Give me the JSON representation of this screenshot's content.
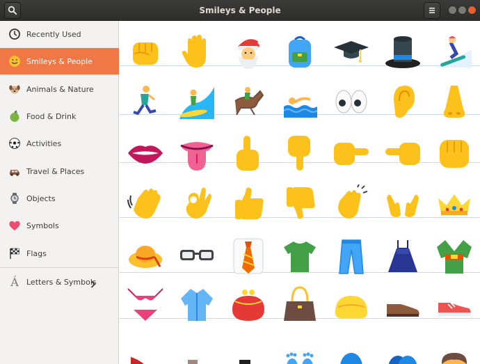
{
  "window": {
    "title": "Smileys & People"
  },
  "header": {
    "search_icon": "search-icon",
    "menu_icon": "hamburger-menu-icon"
  },
  "sidebar": {
    "items": [
      {
        "label": "Recently Used",
        "icon": "clock-icon",
        "active": false
      },
      {
        "label": "Smileys & People",
        "icon": "smiley-icon",
        "active": true
      },
      {
        "label": "Animals & Nature",
        "icon": "dog-icon",
        "active": false
      },
      {
        "label": "Food & Drink",
        "icon": "apple-icon",
        "active": false
      },
      {
        "label": "Activities",
        "icon": "soccer-ball-icon",
        "active": false
      },
      {
        "label": "Travel & Places",
        "icon": "car-icon",
        "active": false
      },
      {
        "label": "Objects",
        "icon": "watch-icon",
        "active": false
      },
      {
        "label": "Symbols",
        "icon": "heart-icon",
        "active": false
      },
      {
        "label": "Flags",
        "icon": "checkered-flag-icon",
        "active": false
      },
      {
        "label": "Letters & Symbols",
        "icon": "accented-a-icon",
        "active": false
      }
    ]
  },
  "emoji_grid": {
    "rows": [
      [
        "raised-fist",
        "raised-hand",
        "santa-claus",
        "backpack",
        "graduation-cap",
        "top-hat",
        "snowboarder"
      ],
      [
        "person-running",
        "person-surfing",
        "horse-racing",
        "person-swimming",
        "eyes",
        "ear",
        "nose"
      ],
      [
        "mouth",
        "tongue",
        "index-pointing-up",
        "index-pointing-down",
        "index-pointing-right",
        "index-pointing-left",
        "oncoming-fist"
      ],
      [
        "waving-hand",
        "ok-hand",
        "thumbs-up",
        "thumbs-down",
        "clapping-hands",
        "open-hands",
        "crown"
      ],
      [
        "womans-hat",
        "glasses",
        "necktie",
        "t-shirt",
        "jeans",
        "dress",
        "kimono"
      ],
      [
        "bikini",
        "womans-clothes",
        "purse",
        "handbag",
        "clutch-bag",
        "mans-shoe",
        "running-shoe"
      ],
      [
        "high-heel",
        "womans-boot",
        "boot",
        "footprints",
        "bust",
        "busts",
        "boy"
      ]
    ]
  }
}
